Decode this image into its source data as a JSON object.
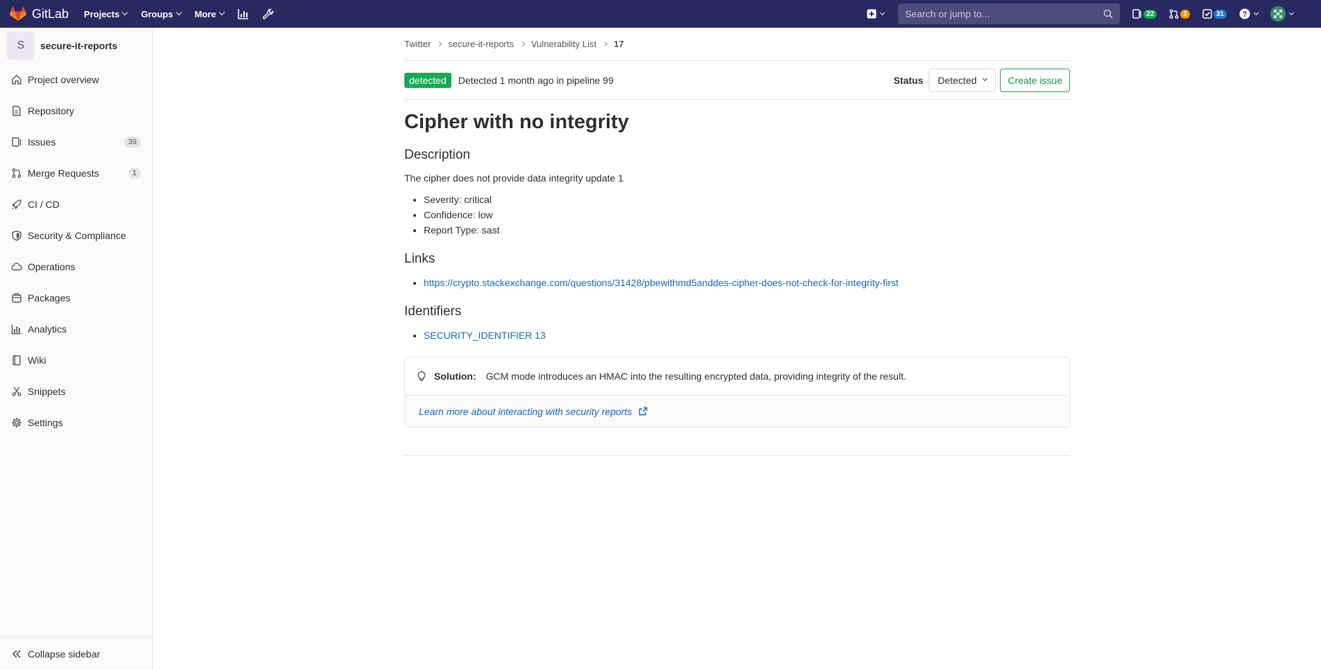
{
  "topbar": {
    "logo_text": "GitLab",
    "nav": [
      {
        "label": "Projects"
      },
      {
        "label": "Groups"
      },
      {
        "label": "More"
      }
    ],
    "search_placeholder": "Search or jump to...",
    "counts": {
      "issues": "22",
      "merge_requests": "2",
      "todos": "31"
    },
    "colors": {
      "bg": "#292961",
      "issues_badge": "#1aaa55",
      "mr_badge": "#fc9403",
      "todos_badge": "#1f78d1"
    }
  },
  "sidebar": {
    "project_avatar": "S",
    "project_name": "secure-it-reports",
    "items": [
      {
        "label": "Project overview",
        "icon": "home-icon"
      },
      {
        "label": "Repository",
        "icon": "doc-icon"
      },
      {
        "label": "Issues",
        "icon": "issues-icon",
        "count": "39"
      },
      {
        "label": "Merge Requests",
        "icon": "merge-request-icon",
        "count": "1"
      },
      {
        "label": "CI / CD",
        "icon": "rocket-icon"
      },
      {
        "label": "Security & Compliance",
        "icon": "shield-icon"
      },
      {
        "label": "Operations",
        "icon": "cloud-icon"
      },
      {
        "label": "Packages",
        "icon": "package-icon"
      },
      {
        "label": "Analytics",
        "icon": "chart-icon"
      },
      {
        "label": "Wiki",
        "icon": "book-icon"
      },
      {
        "label": "Snippets",
        "icon": "scissors-icon"
      },
      {
        "label": "Settings",
        "icon": "gear-icon"
      }
    ],
    "collapse_label": "Collapse sidebar"
  },
  "breadcrumb": [
    "Twitter",
    "secure-it-reports",
    "Vulnerability List",
    "17"
  ],
  "header": {
    "state": "detected",
    "detected_text": "Detected 1 month ago in pipeline 99",
    "status_label": "Status",
    "status_value": "Detected",
    "create_issue": "Create issue"
  },
  "title": "Cipher with no integrity",
  "description": {
    "heading": "Description",
    "text": "The cipher does not provide data integrity update 1",
    "details": [
      "Severity: critical",
      "Confidence: low",
      "Report Type: sast"
    ]
  },
  "links": {
    "heading": "Links",
    "items": [
      "https://crypto.stackexchange.com/questions/31428/pbewithmd5anddes-cipher-does-not-check-for-integrity-first"
    ]
  },
  "identifiers": {
    "heading": "Identifiers",
    "items": [
      "SECURITY_IDENTIFIER 13"
    ]
  },
  "solution": {
    "label": "Solution:",
    "text": "GCM mode introduces an HMAC into the resulting encrypted data, providing integrity of the result.",
    "learn_more": "Learn more about interacting with security reports"
  }
}
